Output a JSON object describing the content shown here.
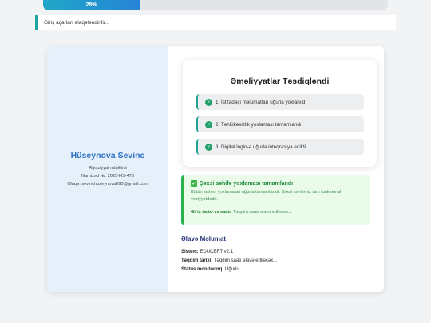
{
  "progress": {
    "percent_label": "28%",
    "value": 0.28
  },
  "status_message": "Giriş açarları əlaqələndirilir...",
  "profile": {
    "name": "Hüseynova Sevinc",
    "role": "Riyaziyyat müəllimi",
    "candidate_no": "Namizəd №: 2025-HS-478",
    "email": "Əlaqə: sevinchuseynova890@gmail.com"
  },
  "confirmation": {
    "title": "Əməliyyatlar Təsdiqləndi",
    "steps": [
      "1. İstifadəçi məlumatları uğurla yoxlanıldı",
      "2. Təhlükəsizlik yoxlaması tamamlandı",
      "3. Digital login-ə uğurla inteqrasiya edildi"
    ]
  },
  "success": {
    "title": "Şəxsi səhifə yoxlaması tamamlandı",
    "body": "Bütün sistem yoxlamaları uğurla tamamlandı. Şəxsi səhifəniz tam funksional vəziyyətdədir.",
    "login_label": "Giriş tarixi və saatı:",
    "login_value": "Təqdim saatı əlavə ediləcək..."
  },
  "extra": {
    "title": "Əlavə Məlumat",
    "system_label": "Sistem:",
    "system_value": "EDUCERT v2.1",
    "date_label": "Təqdim tarixi:",
    "date_value": "Təqdim saatı əlavə ediləcək...",
    "status_label": "Status monitorinq:",
    "status_value": "Uğurlu"
  }
}
